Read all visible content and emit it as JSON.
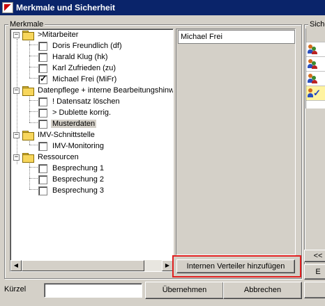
{
  "window": {
    "title": "Merkmale und Sicherheit"
  },
  "merkmale": {
    "label": "Merkmale",
    "tree": [
      {
        "label": ">Mitarbeiter",
        "type": "folder",
        "expanded": true
      },
      {
        "label": "Doris Freundlich (df)",
        "type": "item",
        "checked": false
      },
      {
        "label": "Harald Klug (hk)",
        "type": "item",
        "checked": false
      },
      {
        "label": "Karl Zufrieden (zu)",
        "type": "item",
        "checked": false
      },
      {
        "label": "Michael Frei (MiFr)",
        "type": "item",
        "checked": true
      },
      {
        "label": "Datenpflege + interne Bearbeitungshinweise",
        "type": "folder",
        "expanded": true
      },
      {
        "label": "! Datensatz löschen",
        "type": "item",
        "checked": false
      },
      {
        "label": "> Dublette korrig.",
        "type": "item",
        "checked": false
      },
      {
        "label": "Musterdaten",
        "type": "item",
        "checked": false,
        "selected": true
      },
      {
        "label": "IMV-Schnittstelle",
        "type": "folder",
        "expanded": true
      },
      {
        "label": "IMV-Monitoring",
        "type": "item",
        "checked": false
      },
      {
        "label": "Ressourcen",
        "type": "folder",
        "expanded": true
      },
      {
        "label": "Besprechung 1",
        "type": "item",
        "checked": false
      },
      {
        "label": "Besprechung 2",
        "type": "item",
        "checked": false
      },
      {
        "label": "Besprechung 3",
        "type": "item",
        "checked": false
      }
    ],
    "selected_name": "Michael Frei",
    "add_button": "Internen Verteiler hinzufügen"
  },
  "sicherheit": {
    "label": "Sicher"
  },
  "footer": {
    "kuerzel_label": "Kürzel",
    "kuerzel_value": "",
    "apply_button": "Übernehmen",
    "cancel_button": "Abbrechen"
  },
  "side_buttons": {
    "back_label": "<<",
    "partial_1": "E",
    "partial_2": ""
  },
  "colors": {
    "titlebar": "#0a246a",
    "highlight": "#e02020",
    "folder": "#f7d65c"
  }
}
